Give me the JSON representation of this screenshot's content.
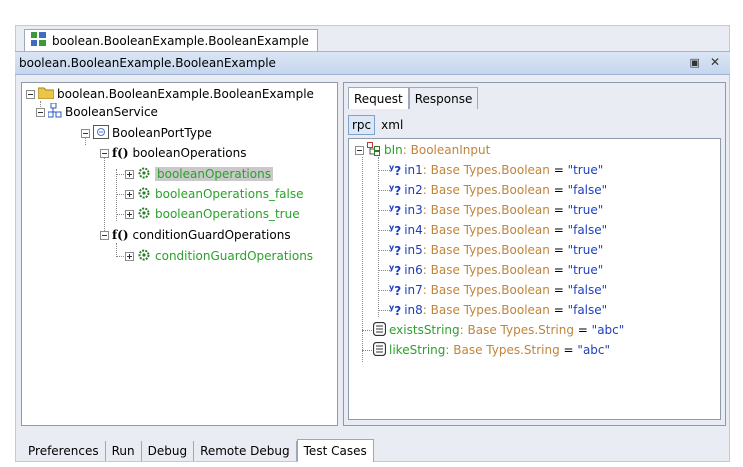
{
  "window": {
    "doc_tab_title": "boolean.BooleanExample.BooleanExample",
    "panel_title": "boolean.BooleanExample.BooleanExample",
    "restore_glyph": "▣",
    "close_glyph": "✕"
  },
  "left_tree": {
    "root": "boolean.BooleanExample.BooleanExample",
    "service": "BooleanService",
    "port_type": "BooleanPortType",
    "fn_glyph": "f()",
    "group1": "booleanOperations",
    "group1_items": [
      "booleanOperations",
      "booleanOperations_false",
      "booleanOperations_true"
    ],
    "group2": "conditionGuardOperations",
    "group2_items": [
      "conditionGuardOperations"
    ]
  },
  "right": {
    "tabs": [
      "Request",
      "Response"
    ],
    "active_tab": "Request",
    "subtabs": [
      "rpc",
      "xml"
    ],
    "active_subtab": "rpc",
    "root_name": "bIn",
    "root_type": "BooleanInput",
    "fields": [
      {
        "name": "in1",
        "type": "Base Types.Boolean",
        "value": "\"true\""
      },
      {
        "name": "in2",
        "type": "Base Types.Boolean",
        "value": "\"false\""
      },
      {
        "name": "in3",
        "type": "Base Types.Boolean",
        "value": "\"true\""
      },
      {
        "name": "in4",
        "type": "Base Types.Boolean",
        "value": "\"false\""
      },
      {
        "name": "in5",
        "type": "Base Types.Boolean",
        "value": "\"true\""
      },
      {
        "name": "in6",
        "type": "Base Types.Boolean",
        "value": "\"true\""
      },
      {
        "name": "in7",
        "type": "Base Types.Boolean",
        "value": "\"false\""
      },
      {
        "name": "in8",
        "type": "Base Types.Boolean",
        "value": "\"false\""
      }
    ],
    "extras": [
      {
        "name": "existsString",
        "type": "Base Types.String",
        "value": "\"abc\""
      },
      {
        "name": "likeString",
        "type": "Base Types.String",
        "value": "\"abc\""
      }
    ]
  },
  "bottom_tabs": [
    "Preferences",
    "Run",
    "Debug",
    "Remote Debug",
    "Test Cases"
  ],
  "active_bottom_tab": "Test Cases",
  "colors": {
    "green_text": "#2aa12a",
    "type_text": "#c1843a",
    "value_text": "#1e3fbf",
    "selection": "#c9c9c9"
  }
}
